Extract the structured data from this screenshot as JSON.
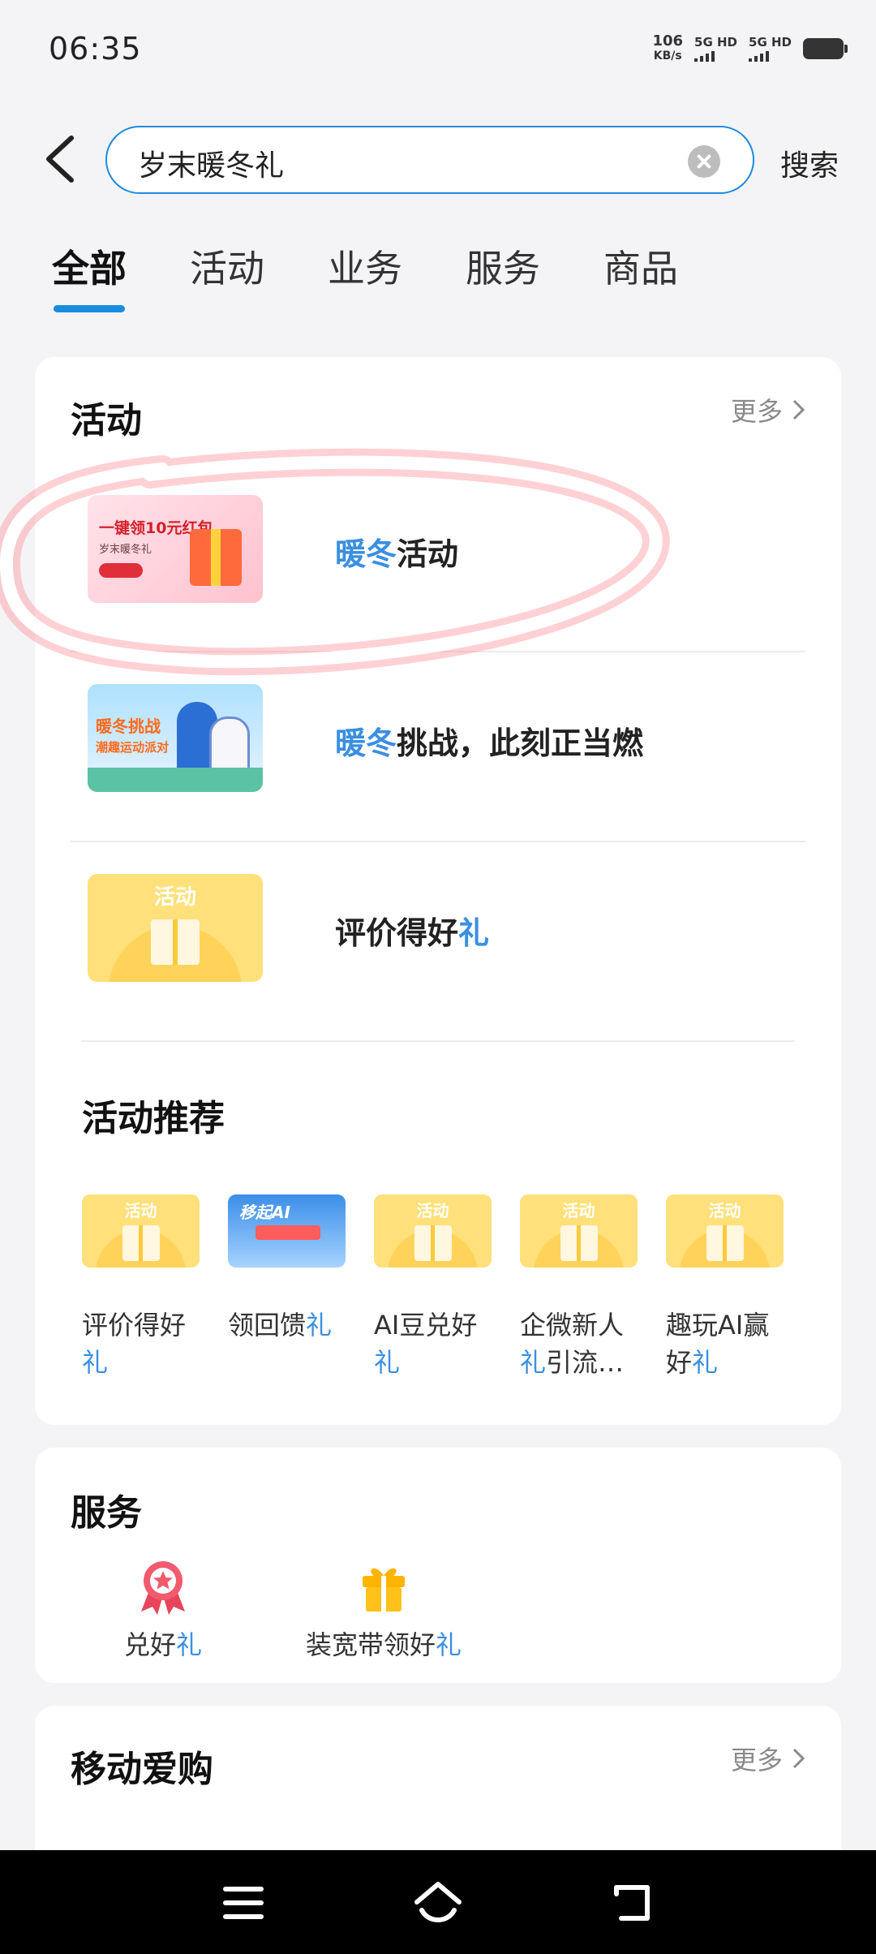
{
  "status_bar": {
    "time": "06:35",
    "net_speed_value": "106",
    "net_speed_unit": "KB/s",
    "sim1_label": "5G HD",
    "sim2_label": "5G HD"
  },
  "search": {
    "query": "岁末暖冬礼",
    "button_label": "搜索"
  },
  "tabs": [
    {
      "label": "全部",
      "active": true
    },
    {
      "label": "活动",
      "active": false
    },
    {
      "label": "业务",
      "active": false
    },
    {
      "label": "服务",
      "active": false
    },
    {
      "label": "商品",
      "active": false
    }
  ],
  "activity_section": {
    "title": "活动",
    "more_label": "更多",
    "items": [
      {
        "title_highlight": "暖冬",
        "title_rest": "活动",
        "thumb_line1": "一键领10元红包",
        "thumb_line2": "岁末暖冬礼"
      },
      {
        "title_highlight": "暖冬",
        "title_rest": "挑战，此刻正当燃",
        "thumb_line1": "暖冬挑战",
        "thumb_line2": "潮趣运动派对"
      },
      {
        "title_prefix": "评价得好",
        "title_highlight": "礼",
        "thumb_label": "活动"
      }
    ]
  },
  "recommend_section": {
    "title": "活动推荐",
    "items": [
      {
        "line1": "评价得好",
        "line2_hl": "礼",
        "line2_rest": "",
        "thumb_label": "活动"
      },
      {
        "line1": "领回馈",
        "line1_hl": "礼",
        "line2_hl": "",
        "line2_rest": "",
        "thumb_label": "移起AI"
      },
      {
        "line1": "AI豆兑好",
        "line2_hl": "礼",
        "line2_rest": "",
        "thumb_label": "活动"
      },
      {
        "line1": "企微新人",
        "line2_hl": "礼",
        "line2_rest": "引流…",
        "thumb_label": "活动"
      },
      {
        "line1": "趣玩AI赢",
        "line2_pre": "好",
        "line2_hl": "礼",
        "line2_rest": "",
        "thumb_label": "活动"
      }
    ]
  },
  "service_section": {
    "title": "服务",
    "items": [
      {
        "pre": "兑好",
        "hl": "礼",
        "icon": "medal-icon"
      },
      {
        "pre": "装宽带领好",
        "hl": "礼",
        "icon": "gift-icon"
      }
    ]
  },
  "shop_section": {
    "title": "移动爱购",
    "more_label": "更多"
  },
  "colors": {
    "accent": "#1a8ce0",
    "highlight_text": "#3a8fe0",
    "annotation_circle": "#e63946"
  }
}
